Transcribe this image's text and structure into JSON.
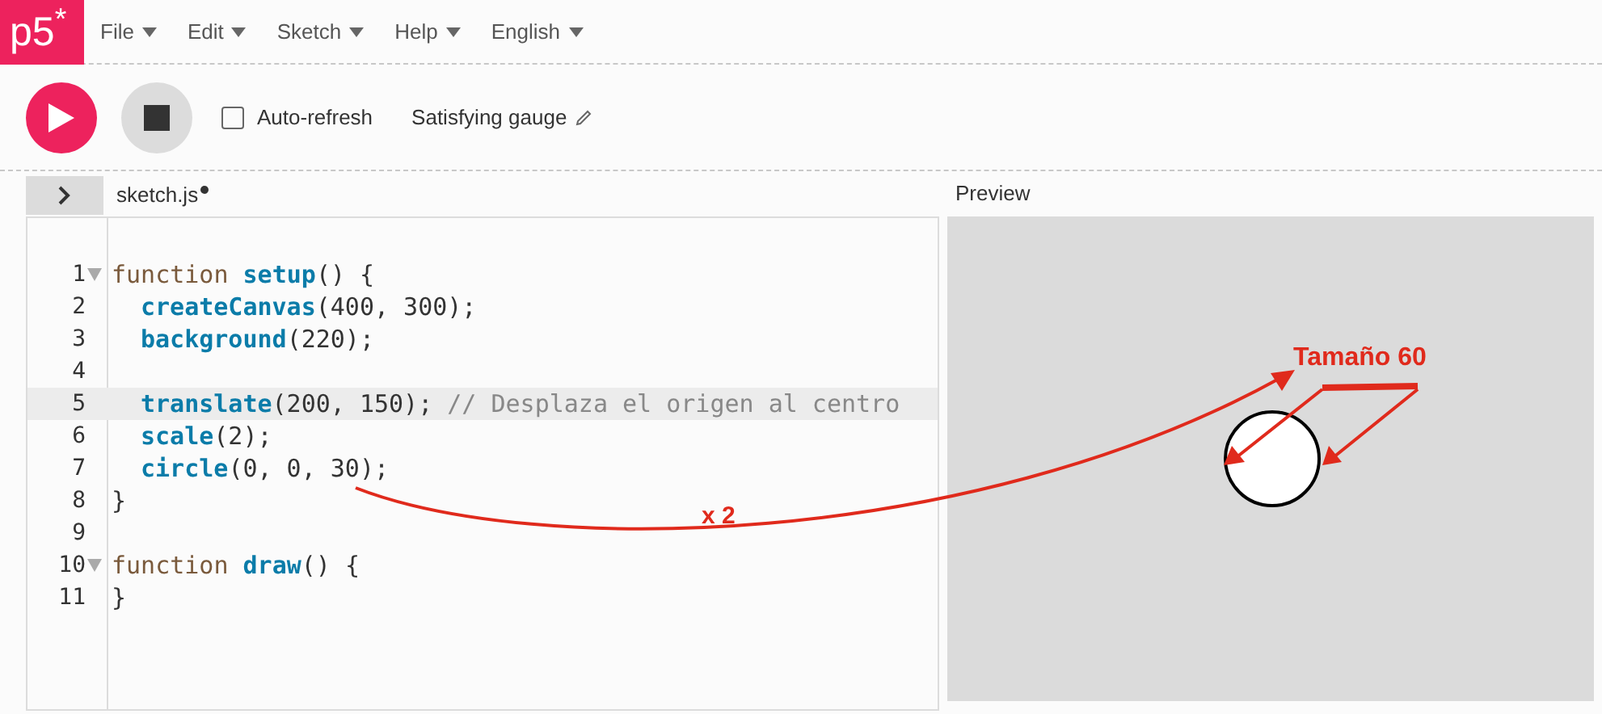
{
  "menu": {
    "logo": "p5$^{*}$",
    "items": [
      {
        "label": "File"
      },
      {
        "label": "Edit"
      },
      {
        "label": "Sketch"
      },
      {
        "label": "Help"
      },
      {
        "label": "English"
      }
    ]
  },
  "toolbar": {
    "auto_refresh": {
      "label": "Auto-refresh",
      "checked": false
    },
    "sketch_name": "Satisfying gauge"
  },
  "editor": {
    "tab": {
      "name": "sketch.js",
      "unsaved": true
    },
    "lines": [
      {
        "number": "1",
        "foldable": true,
        "highlighted": false,
        "indented": false,
        "tokens": [
          {
            "kind": "keyword",
            "text": "function "
          },
          {
            "kind": "name",
            "text": "setup"
          },
          {
            "kind": "plain",
            "text": "() {"
          }
        ]
      },
      {
        "number": "2",
        "foldable": false,
        "highlighted": false,
        "indented": true,
        "tokens": [
          {
            "kind": "name",
            "text": "createCanvas"
          },
          {
            "kind": "plain",
            "text": "(400, 300);"
          }
        ]
      },
      {
        "number": "3",
        "foldable": false,
        "highlighted": false,
        "indented": true,
        "tokens": [
          {
            "kind": "name",
            "text": "background"
          },
          {
            "kind": "plain",
            "text": "(220);"
          }
        ]
      },
      {
        "number": "4",
        "foldable": false,
        "highlighted": false
      },
      {
        "number": "5",
        "foldable": false,
        "highlighted": true,
        "indented": true,
        "tokens": [
          {
            "kind": "name",
            "text": "translate"
          },
          {
            "kind": "plain",
            "text": "(200, 150); "
          },
          {
            "kind": "comment",
            "text": "// Desplaza el origen al centro"
          }
        ]
      },
      {
        "number": "6",
        "foldable": false,
        "highlighted": false,
        "indented": true,
        "tokens": [
          {
            "kind": "name",
            "text": "scale"
          },
          {
            "kind": "plain",
            "text": "(2);"
          }
        ]
      },
      {
        "number": "7",
        "foldable": false,
        "highlighted": false,
        "indented": true,
        "tokens": [
          {
            "kind": "name",
            "text": "circle"
          },
          {
            "kind": "plain",
            "text": "(0, 0, 30);"
          }
        ]
      },
      {
        "number": "8",
        "foldable": false,
        "highlighted": false,
        "indented": false,
        "tokens": [
          {
            "kind": "plain",
            "text": "}"
          }
        ]
      },
      {
        "number": "9",
        "foldable": false,
        "highlighted": false
      },
      {
        "number": "10",
        "foldable": true,
        "highlighted": false,
        "indented": false,
        "tokens": [
          {
            "kind": "keyword",
            "text": "function "
          },
          {
            "kind": "name",
            "text": "draw"
          },
          {
            "kind": "plain",
            "text": "() {"
          }
        ]
      },
      {
        "number": "11",
        "foldable": false,
        "highlighted": false,
        "indented": false,
        "tokens": [
          {
            "kind": "plain",
            "text": "}"
          }
        ]
      }
    ]
  },
  "preview": {
    "label": "Preview"
  },
  "annotations": {
    "multiplier": "x 2",
    "size_label": "Tamaño 60"
  }
}
